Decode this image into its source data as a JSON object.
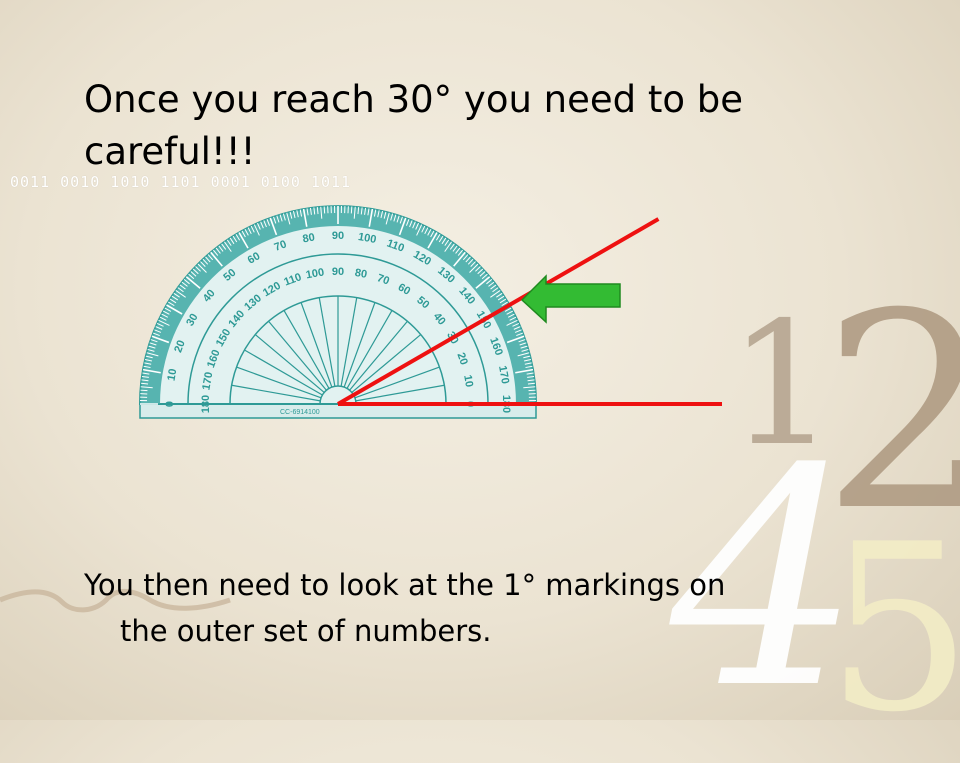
{
  "slide": {
    "title": "Once you reach 30° you need to be careful!!!",
    "caption_line1": "You then need to look at the 1° markings on",
    "caption_line2": "the outer set of numbers.",
    "binary_strip": "0011 0010 1010 1101 0001 0100 1011"
  },
  "decor": {
    "digit_1": "1",
    "digit_2": "2",
    "digit_4": "4",
    "digit_5": "5"
  },
  "protractor": {
    "outer_labels": [
      "0",
      "10",
      "20",
      "30",
      "40",
      "50",
      "60",
      "70",
      "80",
      "90",
      "100",
      "110",
      "120",
      "130",
      "140",
      "150",
      "160",
      "170",
      "180"
    ],
    "inner_labels": [
      "180",
      "170",
      "160",
      "150",
      "140",
      "130",
      "120",
      "110",
      "100",
      "90",
      "80",
      "70",
      "60",
      "50",
      "40",
      "30",
      "20",
      "10",
      "0"
    ],
    "model_code": "CC-6914100",
    "color": "#2e9a96"
  },
  "angle": {
    "degrees": 30,
    "ray_color": "#ee1111"
  },
  "arrow": {
    "icon": "arrow-left-icon",
    "color": "#33bb33"
  }
}
